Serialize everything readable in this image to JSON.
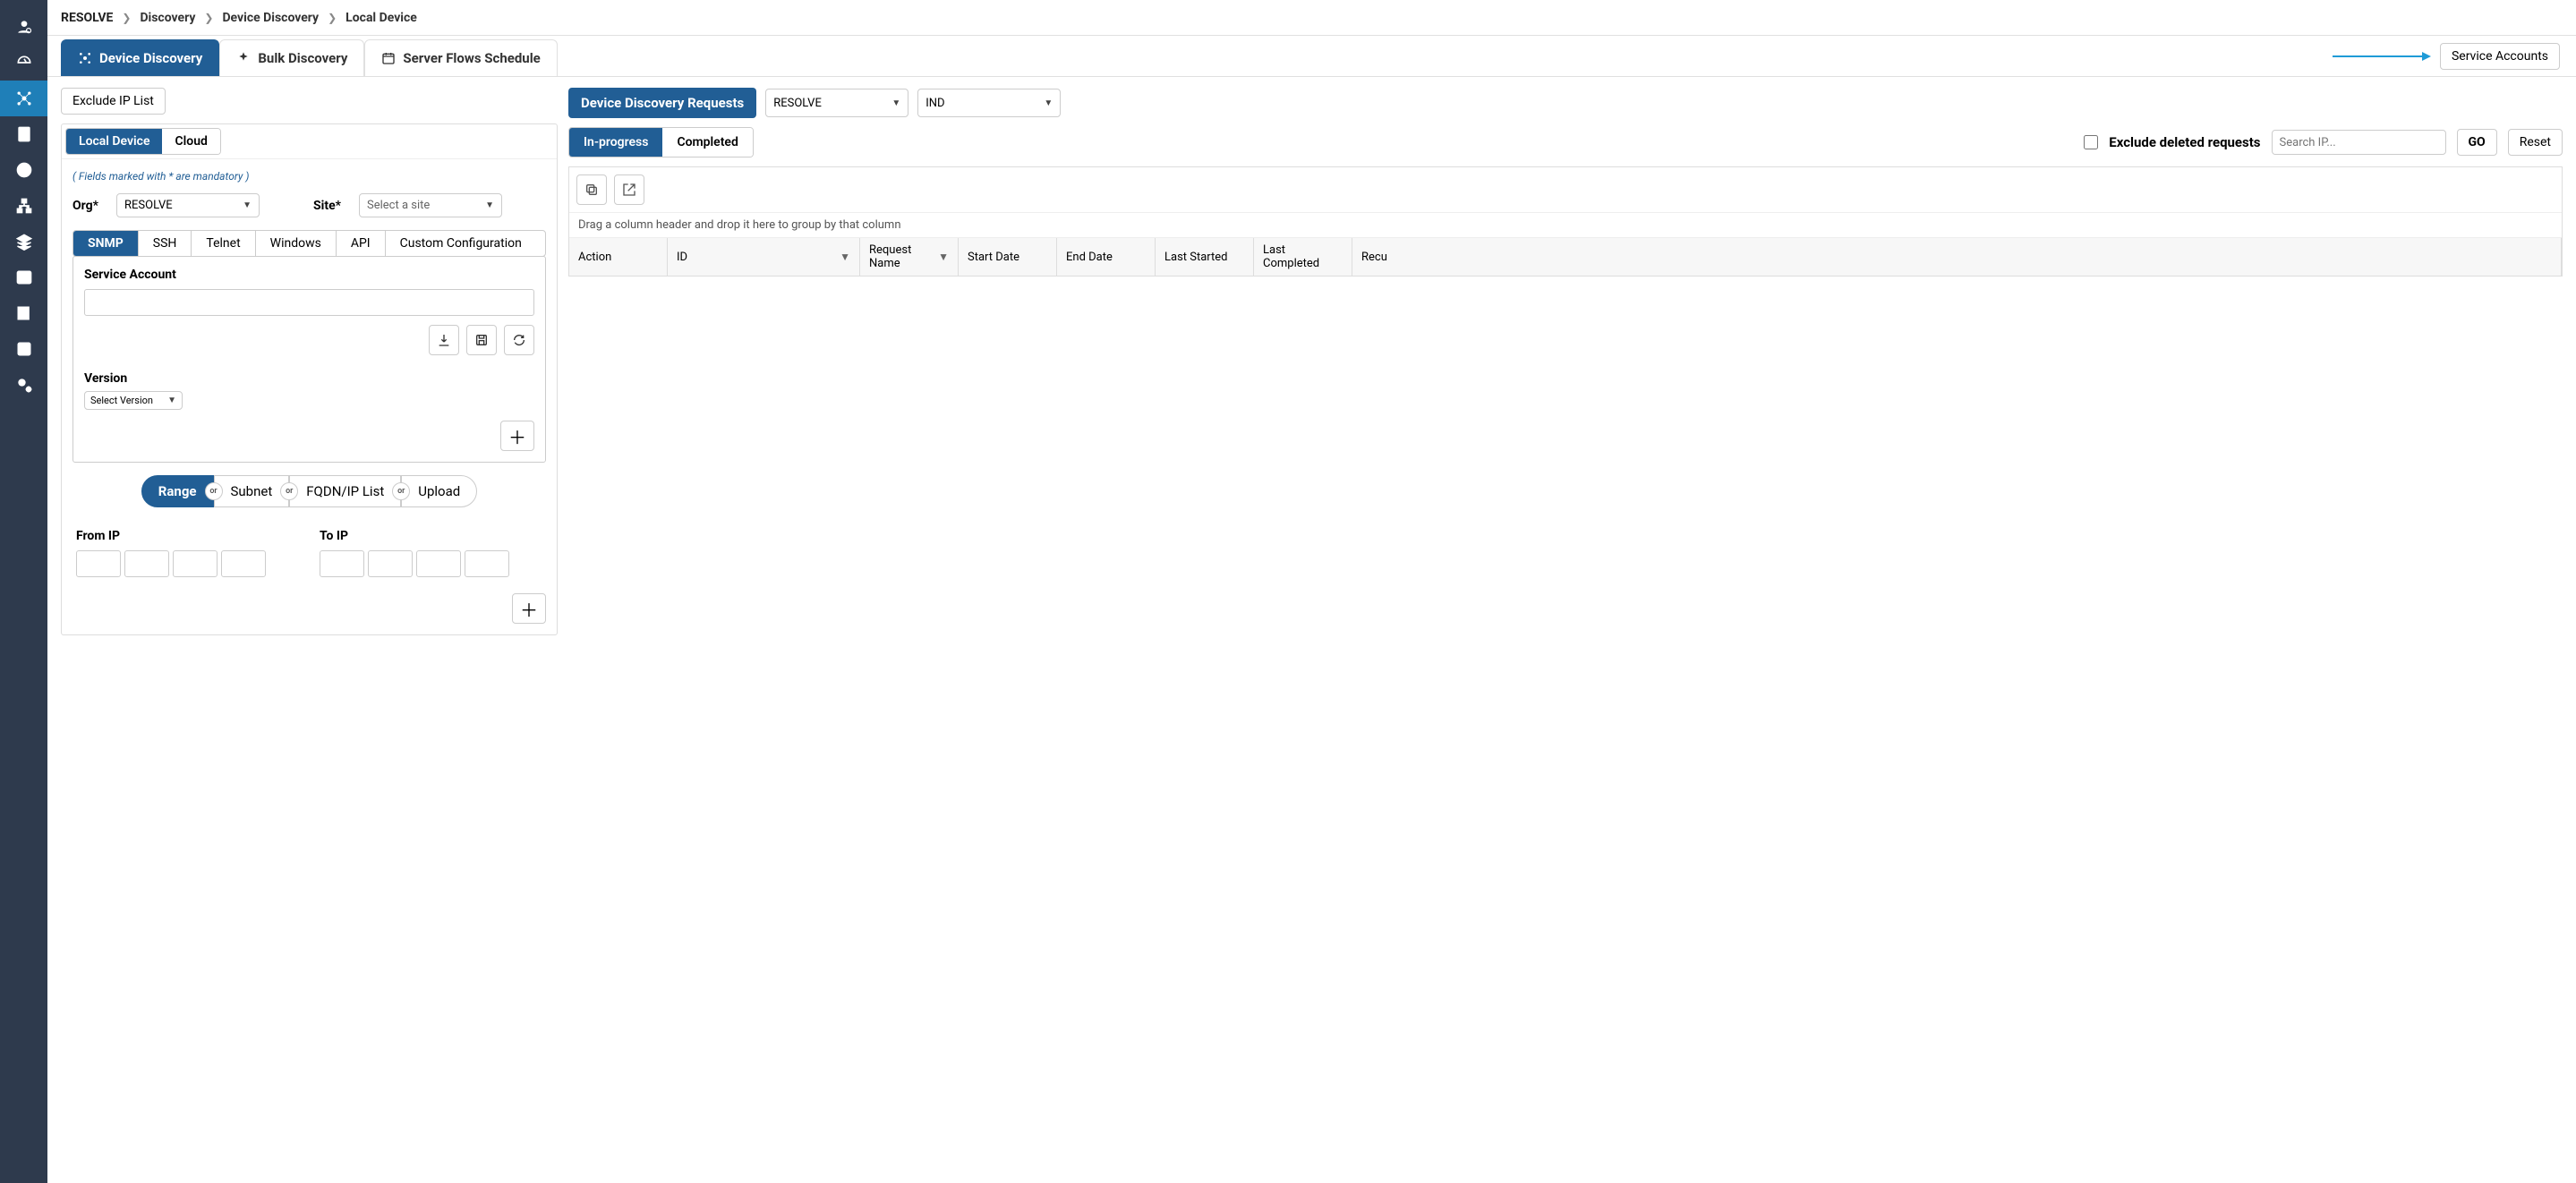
{
  "breadcrumb": {
    "root": "RESOLVE",
    "items": [
      "Discovery",
      "Device Discovery",
      "Local Device"
    ]
  },
  "tabs": {
    "device_discovery": "Device Discovery",
    "bulk_discovery": "Bulk Discovery",
    "server_flows": "Server Flows Schedule"
  },
  "topright": {
    "service_accounts": "Service Accounts"
  },
  "left_panel": {
    "exclude_ip": "Exclude IP List",
    "sub_tabs": {
      "local": "Local Device",
      "cloud": "Cloud"
    },
    "note": "( Fields marked with * are mandatory )",
    "org_label": "Org*",
    "org_value": "RESOLVE",
    "site_label": "Site*",
    "site_placeholder": "Select a site",
    "proto_tabs": {
      "snmp": "SNMP",
      "ssh": "SSH",
      "telnet": "Telnet",
      "windows": "Windows",
      "api": "API",
      "custom": "Custom Configuration"
    },
    "service_account_label": "Service Account",
    "version_label": "Version",
    "version_placeholder": "Select Version",
    "range_tabs": {
      "range": "Range",
      "subnet": "Subnet",
      "fqdn": "FQDN/IP List",
      "upload": "Upload",
      "or": "or"
    },
    "from_ip": "From IP",
    "to_ip": "To IP"
  },
  "right_panel": {
    "title": "Device Discovery Requests",
    "org_value": "RESOLVE",
    "region_value": "IND",
    "status_tabs": {
      "inprogress": "In-progress",
      "completed": "Completed"
    },
    "exclude_deleted": "Exclude deleted requests",
    "search_placeholder": "Search IP...",
    "go": "GO",
    "reset": "Reset",
    "drag_hint": "Drag a column header and drop it here to group by that column",
    "cols": {
      "action": "Action",
      "id": "ID",
      "reqname": "Request Name",
      "start": "Start Date",
      "end": "End Date",
      "laststart": "Last Started",
      "lastcomp": "Last Completed",
      "recur": "Recu"
    }
  }
}
